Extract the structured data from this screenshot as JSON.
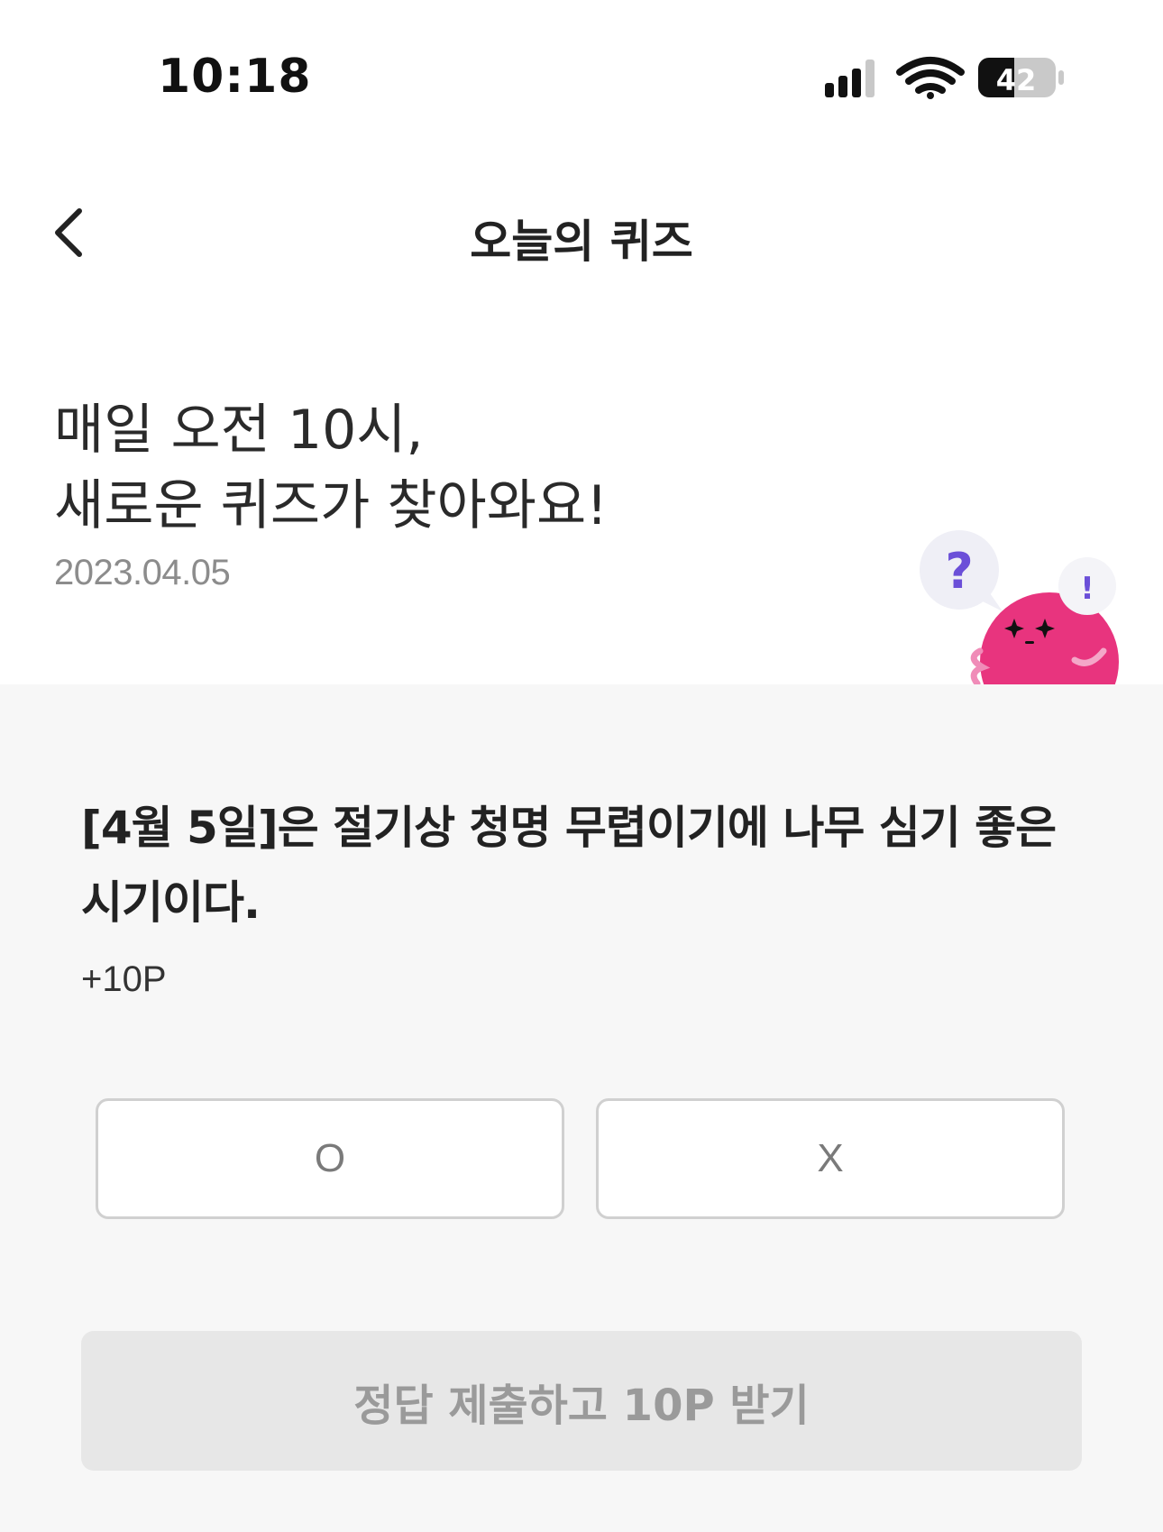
{
  "status_bar": {
    "time": "10:18",
    "battery": "42",
    "icons": [
      "cellular-signal-icon",
      "wifi-icon",
      "battery-icon"
    ]
  },
  "header": {
    "title": "오늘의 퀴즈",
    "back_icon": "chevron-left-icon"
  },
  "intro": {
    "line1": "매일 오전 10시,",
    "line2": "새로운 퀴즈가 찾아와요!",
    "date": "2023.04.05"
  },
  "mascot": {
    "question_mark": "?",
    "exclamation_mark": "!"
  },
  "quiz": {
    "question": "[4월 5일]은 절기상 청명 무렵이기에 나무 심기 좋은 시기이다.",
    "points": "+10P",
    "option_o": "O",
    "option_x": "X",
    "submit_label": "정답 제출하고 10P 받기"
  },
  "colors": {
    "mascot_pink": "#e8347e",
    "accent_purple": "#6b4fd8",
    "panel_bg": "#f7f7f7",
    "submit_disabled_bg": "#e7e7e7"
  }
}
